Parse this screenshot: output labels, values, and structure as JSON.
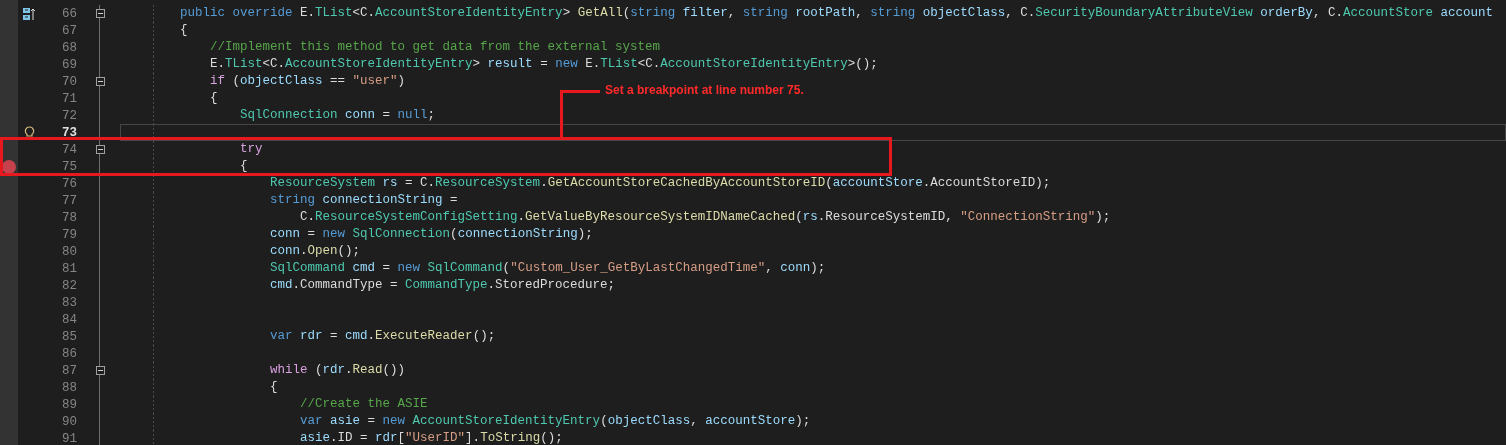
{
  "editor": {
    "lines": [
      {
        "number": "66",
        "kind": "override",
        "breakpoint": false,
        "foldable": true,
        "current": false,
        "code": [
          {
            "kind": "keyword",
            "text": "        public "
          },
          {
            "kind": "keyword",
            "text": "override "
          },
          {
            "kind": "plain",
            "text": "E."
          },
          {
            "kind": "type",
            "text": "TList"
          },
          {
            "kind": "plain",
            "text": "<C."
          },
          {
            "kind": "type",
            "text": "AccountStoreIdentityEntry"
          },
          {
            "kind": "plain",
            "text": "> "
          },
          {
            "kind": "method",
            "text": "GetAll"
          },
          {
            "kind": "plain",
            "text": "("
          },
          {
            "kind": "keyword",
            "text": "string "
          },
          {
            "kind": "local",
            "text": "filter"
          },
          {
            "kind": "plain",
            "text": ", "
          },
          {
            "kind": "keyword",
            "text": "string "
          },
          {
            "kind": "local",
            "text": "rootPath"
          },
          {
            "kind": "plain",
            "text": ", "
          },
          {
            "kind": "keyword",
            "text": "string "
          },
          {
            "kind": "local",
            "text": "objectClass"
          },
          {
            "kind": "plain",
            "text": ", C."
          },
          {
            "kind": "type",
            "text": "SecurityBoundaryAttributeView "
          },
          {
            "kind": "local",
            "text": "orderBy"
          },
          {
            "kind": "plain",
            "text": ", C."
          },
          {
            "kind": "type",
            "text": "AccountStore "
          },
          {
            "kind": "local",
            "text": "account"
          }
        ]
      },
      {
        "number": "67",
        "kind": "plain",
        "breakpoint": false,
        "foldable": false,
        "current": false,
        "code": [
          {
            "kind": "plain",
            "text": "        {"
          }
        ]
      },
      {
        "number": "68",
        "kind": "plain",
        "breakpoint": false,
        "foldable": false,
        "current": false,
        "code": [
          {
            "kind": "comment",
            "text": "            //Implement this method to get data from the external system"
          }
        ]
      },
      {
        "number": "69",
        "kind": "plain",
        "breakpoint": false,
        "foldable": false,
        "current": false,
        "code": [
          {
            "kind": "plain",
            "text": "            E."
          },
          {
            "kind": "type",
            "text": "TList"
          },
          {
            "kind": "plain",
            "text": "<C."
          },
          {
            "kind": "type",
            "text": "AccountStoreIdentityEntry"
          },
          {
            "kind": "plain",
            "text": "> "
          },
          {
            "kind": "local",
            "text": "result"
          },
          {
            "kind": "plain",
            "text": " = "
          },
          {
            "kind": "keyword",
            "text": "new "
          },
          {
            "kind": "plain",
            "text": "E."
          },
          {
            "kind": "type",
            "text": "TList"
          },
          {
            "kind": "plain",
            "text": "<C."
          },
          {
            "kind": "type",
            "text": "AccountStoreIdentityEntry"
          },
          {
            "kind": "plain",
            "text": ">();"
          }
        ]
      },
      {
        "number": "70",
        "kind": "plain",
        "breakpoint": false,
        "foldable": true,
        "current": false,
        "code": [
          {
            "kind": "control",
            "text": "            if"
          },
          {
            "kind": "plain",
            "text": " ("
          },
          {
            "kind": "local",
            "text": "objectClass"
          },
          {
            "kind": "plain",
            "text": " == "
          },
          {
            "kind": "string",
            "text": "\"user\""
          },
          {
            "kind": "plain",
            "text": ")"
          }
        ]
      },
      {
        "number": "71",
        "kind": "plain",
        "breakpoint": false,
        "foldable": false,
        "current": false,
        "code": [
          {
            "kind": "plain",
            "text": "            {"
          }
        ]
      },
      {
        "number": "72",
        "kind": "plain",
        "breakpoint": false,
        "foldable": false,
        "current": false,
        "code": [
          {
            "kind": "type",
            "text": "                SqlConnection "
          },
          {
            "kind": "local",
            "text": "conn"
          },
          {
            "kind": "plain",
            "text": " = "
          },
          {
            "kind": "keyword",
            "text": "null"
          },
          {
            "kind": "plain",
            "text": ";"
          }
        ]
      },
      {
        "number": "73",
        "kind": "lightbulb",
        "breakpoint": false,
        "foldable": false,
        "current": true
      },
      {
        "number": "74",
        "kind": "plain",
        "breakpoint": false,
        "foldable": true,
        "current": false,
        "code": [
          {
            "kind": "control",
            "text": "                try"
          }
        ]
      },
      {
        "number": "75",
        "kind": "plain",
        "breakpoint": true,
        "foldable": false,
        "current": false,
        "code": [
          {
            "kind": "plain",
            "text": "                {"
          }
        ]
      },
      {
        "number": "76",
        "kind": "plain",
        "breakpoint": false,
        "foldable": false,
        "current": false,
        "code": [
          {
            "kind": "type",
            "text": "                    ResourceSystem "
          },
          {
            "kind": "local",
            "text": "rs"
          },
          {
            "kind": "plain",
            "text": " = C."
          },
          {
            "kind": "type",
            "text": "ResourceSystem"
          },
          {
            "kind": "plain",
            "text": "."
          },
          {
            "kind": "method",
            "text": "GetAccountStoreCachedByAccountStoreID"
          },
          {
            "kind": "plain",
            "text": "("
          },
          {
            "kind": "local",
            "text": "accountStore"
          },
          {
            "kind": "plain",
            "text": ".AccountStoreID);"
          }
        ]
      },
      {
        "number": "77",
        "kind": "plain",
        "breakpoint": false,
        "foldable": false,
        "current": false,
        "code": [
          {
            "kind": "keyword",
            "text": "                    string "
          },
          {
            "kind": "local",
            "text": "connectionString"
          },
          {
            "kind": "plain",
            "text": " ="
          }
        ]
      },
      {
        "number": "78",
        "kind": "plain",
        "breakpoint": false,
        "foldable": false,
        "current": false,
        "code": [
          {
            "kind": "plain",
            "text": "                        C."
          },
          {
            "kind": "type",
            "text": "ResourceSystemConfigSetting"
          },
          {
            "kind": "plain",
            "text": "."
          },
          {
            "kind": "method",
            "text": "GetValueByResourceSystemIDNameCached"
          },
          {
            "kind": "plain",
            "text": "("
          },
          {
            "kind": "local",
            "text": "rs"
          },
          {
            "kind": "plain",
            "text": ".ResourceSystemID, "
          },
          {
            "kind": "string",
            "text": "\"ConnectionString\""
          },
          {
            "kind": "plain",
            "text": ");"
          }
        ]
      },
      {
        "number": "79",
        "kind": "plain",
        "breakpoint": false,
        "foldable": false,
        "current": false,
        "code": [
          {
            "kind": "local",
            "text": "                    conn"
          },
          {
            "kind": "plain",
            "text": " = "
          },
          {
            "kind": "keyword",
            "text": "new "
          },
          {
            "kind": "type",
            "text": "SqlConnection"
          },
          {
            "kind": "plain",
            "text": "("
          },
          {
            "kind": "local",
            "text": "connectionString"
          },
          {
            "kind": "plain",
            "text": ");"
          }
        ]
      },
      {
        "number": "80",
        "kind": "plain",
        "breakpoint": false,
        "foldable": false,
        "current": false,
        "code": [
          {
            "kind": "local",
            "text": "                    conn"
          },
          {
            "kind": "plain",
            "text": "."
          },
          {
            "kind": "method",
            "text": "Open"
          },
          {
            "kind": "plain",
            "text": "();"
          }
        ]
      },
      {
        "number": "81",
        "kind": "plain",
        "breakpoint": false,
        "foldable": false,
        "current": false,
        "code": [
          {
            "kind": "type",
            "text": "                    SqlCommand "
          },
          {
            "kind": "local",
            "text": "cmd"
          },
          {
            "kind": "plain",
            "text": " = "
          },
          {
            "kind": "keyword",
            "text": "new "
          },
          {
            "kind": "type",
            "text": "SqlCommand"
          },
          {
            "kind": "plain",
            "text": "("
          },
          {
            "kind": "string",
            "text": "\"Custom_User_GetByLastChangedTime\""
          },
          {
            "kind": "plain",
            "text": ", "
          },
          {
            "kind": "local",
            "text": "conn"
          },
          {
            "kind": "plain",
            "text": ");"
          }
        ]
      },
      {
        "number": "82",
        "kind": "plain",
        "breakpoint": false,
        "foldable": false,
        "current": false,
        "code": [
          {
            "kind": "local",
            "text": "                    cmd"
          },
          {
            "kind": "plain",
            "text": ".CommandType = "
          },
          {
            "kind": "type",
            "text": "CommandType"
          },
          {
            "kind": "plain",
            "text": ".StoredProcedure;"
          }
        ]
      },
      {
        "number": "83",
        "kind": "plain",
        "breakpoint": false,
        "foldable": false,
        "current": false
      },
      {
        "number": "84",
        "kind": "plain",
        "breakpoint": false,
        "foldable": false,
        "current": false
      },
      {
        "number": "85",
        "kind": "plain",
        "breakpoint": false,
        "foldable": false,
        "current": false,
        "code": [
          {
            "kind": "keyword",
            "text": "                    var "
          },
          {
            "kind": "local",
            "text": "rdr"
          },
          {
            "kind": "plain",
            "text": " = "
          },
          {
            "kind": "local",
            "text": "cmd"
          },
          {
            "kind": "plain",
            "text": "."
          },
          {
            "kind": "method",
            "text": "ExecuteReader"
          },
          {
            "kind": "plain",
            "text": "();"
          }
        ]
      },
      {
        "number": "86",
        "kind": "plain",
        "breakpoint": false,
        "foldable": false,
        "current": false
      },
      {
        "number": "87",
        "kind": "plain",
        "breakpoint": false,
        "foldable": true,
        "current": false,
        "code": [
          {
            "kind": "control",
            "text": "                    while"
          },
          {
            "kind": "plain",
            "text": " ("
          },
          {
            "kind": "local",
            "text": "rdr"
          },
          {
            "kind": "plain",
            "text": "."
          },
          {
            "kind": "method",
            "text": "Read"
          },
          {
            "kind": "plain",
            "text": "())"
          }
        ]
      },
      {
        "number": "88",
        "kind": "plain",
        "breakpoint": false,
        "foldable": false,
        "current": false,
        "code": [
          {
            "kind": "plain",
            "text": "                    {"
          }
        ]
      },
      {
        "number": "89",
        "kind": "plain",
        "breakpoint": false,
        "foldable": false,
        "current": false,
        "code": [
          {
            "kind": "comment",
            "text": "                        //Create the ASIE"
          }
        ]
      },
      {
        "number": "90",
        "kind": "plain",
        "breakpoint": false,
        "foldable": false,
        "current": false,
        "code": [
          {
            "kind": "keyword",
            "text": "                        var "
          },
          {
            "kind": "local",
            "text": "asie"
          },
          {
            "kind": "plain",
            "text": " = "
          },
          {
            "kind": "keyword",
            "text": "new "
          },
          {
            "kind": "type",
            "text": "AccountStoreIdentityEntry"
          },
          {
            "kind": "plain",
            "text": "("
          },
          {
            "kind": "local",
            "text": "objectClass"
          },
          {
            "kind": "plain",
            "text": ", "
          },
          {
            "kind": "local",
            "text": "accountStore"
          },
          {
            "kind": "plain",
            "text": ");"
          }
        ]
      },
      {
        "number": "91",
        "kind": "plain",
        "breakpoint": false,
        "foldable": false,
        "current": false,
        "code": [
          {
            "kind": "local",
            "text": "                        asie"
          },
          {
            "kind": "plain",
            "text": ".ID = "
          },
          {
            "kind": "local",
            "text": "rdr"
          },
          {
            "kind": "plain",
            "text": "["
          },
          {
            "kind": "string",
            "text": "\"UserID\""
          },
          {
            "kind": "plain",
            "text": "]."
          },
          {
            "kind": "method",
            "text": "ToString"
          },
          {
            "kind": "plain",
            "text": "();"
          }
        ]
      }
    ]
  },
  "annotation": {
    "text": "Set a breakpoint at line number 75."
  }
}
